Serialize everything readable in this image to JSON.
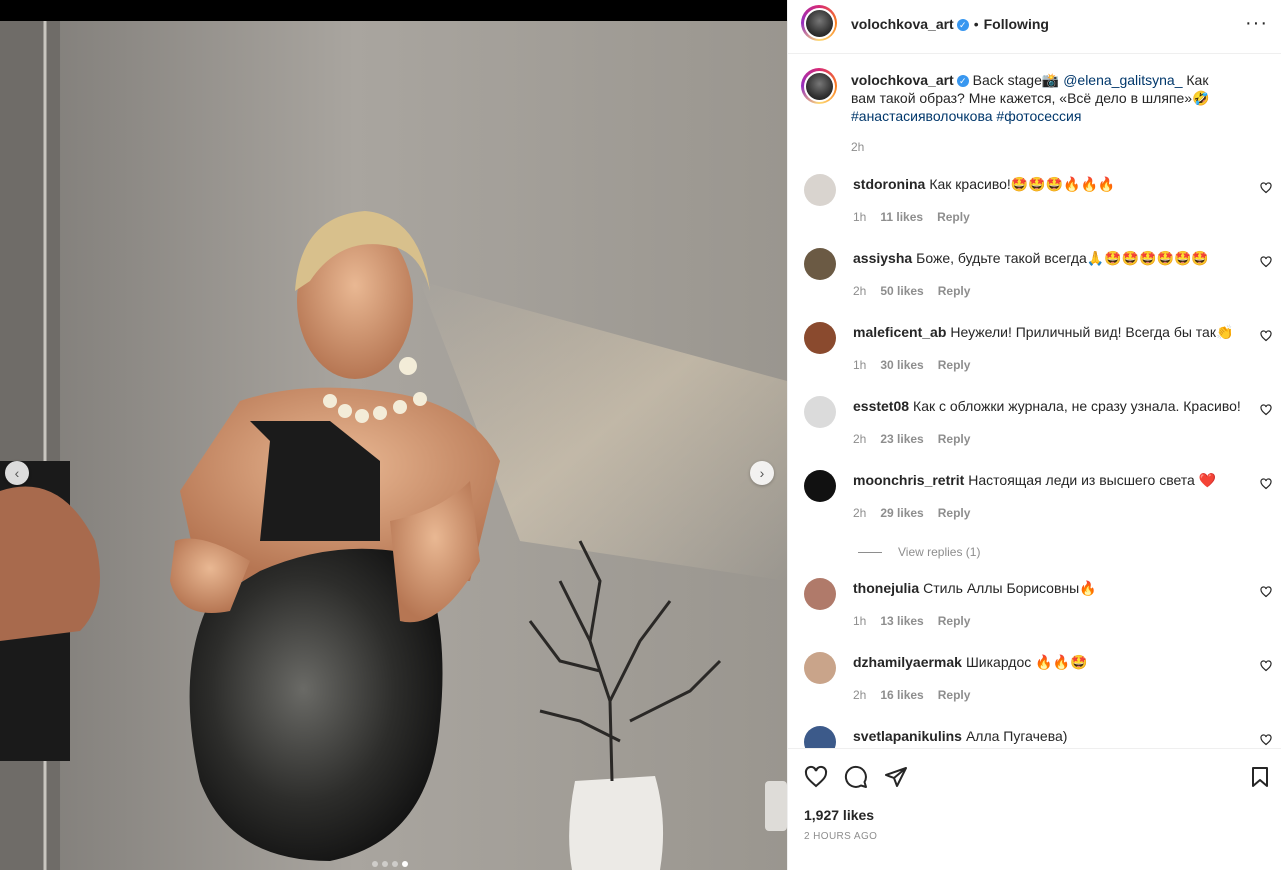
{
  "post": {
    "username": "volochkova_art",
    "following_label": "Following",
    "caption_text1": " Back stage📸 ",
    "caption_mention": "@elena_galitsyna_",
    "caption_text2": " Как вам такой образ? Мне кажется, «Всё дело в шляпе»🤣",
    "caption_tags": "#анастасияволочкова #фотосессия",
    "caption_time": "2h",
    "likes": "1,927 likes",
    "posted": "2 HOURS AGO"
  },
  "comments": [
    {
      "username": "stdoronina",
      "text": "Как красиво!🤩🤩🤩🔥🔥🔥",
      "time": "1h",
      "likes": "11 likes",
      "reply": "Reply",
      "avatar_color": "#d9d4cf"
    },
    {
      "username": "assiysha",
      "text": "Боже, будьте такой всегда🙏🤩🤩🤩🤩🤩🤩",
      "time": "2h",
      "likes": "50 likes",
      "reply": "Reply",
      "avatar_color": "#6b5a44"
    },
    {
      "username": "maleficent_ab",
      "text": "Неужели! Приличный вид! Всегда бы так👏",
      "time": "1h",
      "likes": "30 likes",
      "reply": "Reply",
      "avatar_color": "#8a4a2e"
    },
    {
      "username": "esstet08",
      "text": "Как с обложки журнала, не сразу узнала. Красиво!",
      "time": "2h",
      "likes": "23 likes",
      "reply": "Reply",
      "avatar_color": "#dbdbdb"
    },
    {
      "username": "moonchris_retrit",
      "text": "Настоящая леди из высшего света ❤️",
      "time": "2h",
      "likes": "29 likes",
      "reply": "Reply",
      "avatar_color": "#111111"
    },
    {
      "username": "thonejulia",
      "text": "Стиль Аллы Борисовны🔥",
      "time": "1h",
      "likes": "13 likes",
      "reply": "Reply",
      "avatar_color": "#b07a6a"
    },
    {
      "username": "dzhamilyaermak",
      "text": "Шикардос 🔥🔥🤩",
      "time": "2h",
      "likes": "16 likes",
      "reply": "Reply",
      "avatar_color": "#c9a48a"
    },
    {
      "username": "svetlapanikulins",
      "text": "Алла Пугачева)",
      "time": "",
      "likes": "",
      "reply": "",
      "avatar_color": "#3c5a8a"
    }
  ],
  "view_replies": "View replies (1)",
  "icons": {
    "prev": "chevron-left-icon",
    "next": "chevron-right-icon",
    "more": "more-options-icon",
    "like": "heart-icon",
    "comment": "comment-icon",
    "share": "share-icon",
    "save": "bookmark-icon"
  },
  "colors": {
    "link": "#00376b",
    "verified": "#3897f0",
    "muted": "#8e8e8e"
  }
}
